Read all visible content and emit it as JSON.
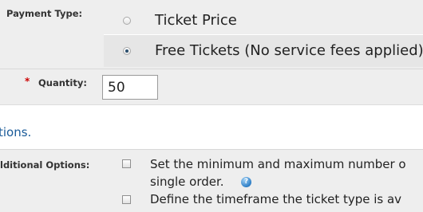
{
  "payment_type": {
    "label": "Payment Type:",
    "options": [
      {
        "label": "Ticket Price",
        "selected": false
      },
      {
        "label": "Free Tickets (No service fees applied)",
        "selected": true
      }
    ]
  },
  "quantity": {
    "required_marker": "*",
    "label": "Quantity:",
    "value": "50"
  },
  "link": {
    "text": "tions."
  },
  "additional_options": {
    "label": "lditional Options:",
    "options": [
      {
        "line1": "Set the minimum and maximum number o",
        "line2": "single order.",
        "checked": false,
        "has_help": true
      },
      {
        "line1": "Define the timeframe the ticket type is av",
        "checked": false
      }
    ],
    "help_glyph": "?"
  },
  "colors": {
    "link": "#1a5b99",
    "required": "#cc0000",
    "panel_bg": "#eeeeee",
    "radio_selected": "#2b4f6e"
  }
}
